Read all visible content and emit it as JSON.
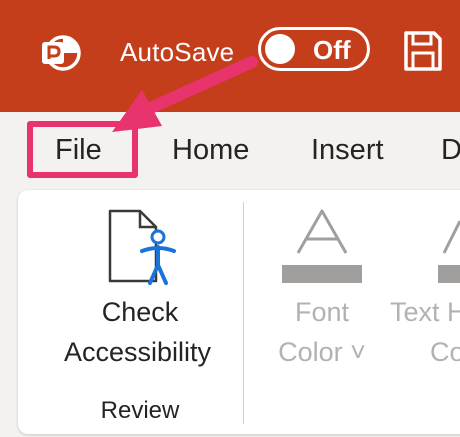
{
  "titlebar": {
    "app_icon": "powerpoint-logo-icon",
    "autosave_label": "AutoSave",
    "toggle_state": "Off",
    "save_icon": "save-icon",
    "background_color": "#c43e1c"
  },
  "tabs": [
    "File",
    "Home",
    "Insert",
    "D"
  ],
  "highlight_color": "#e8336d",
  "ribbon": {
    "check_accessibility": {
      "line1": "Check",
      "line2": "Accessibility",
      "icon": "document-accessibility-icon"
    },
    "review_group_label": "Review",
    "font_color": {
      "line1": "Font",
      "line2": "Color ˅",
      "icon": "font-color-icon"
    },
    "text_highlight": {
      "line1": "Text H",
      "line2": "Co",
      "icon": "text-highlight-icon"
    }
  }
}
